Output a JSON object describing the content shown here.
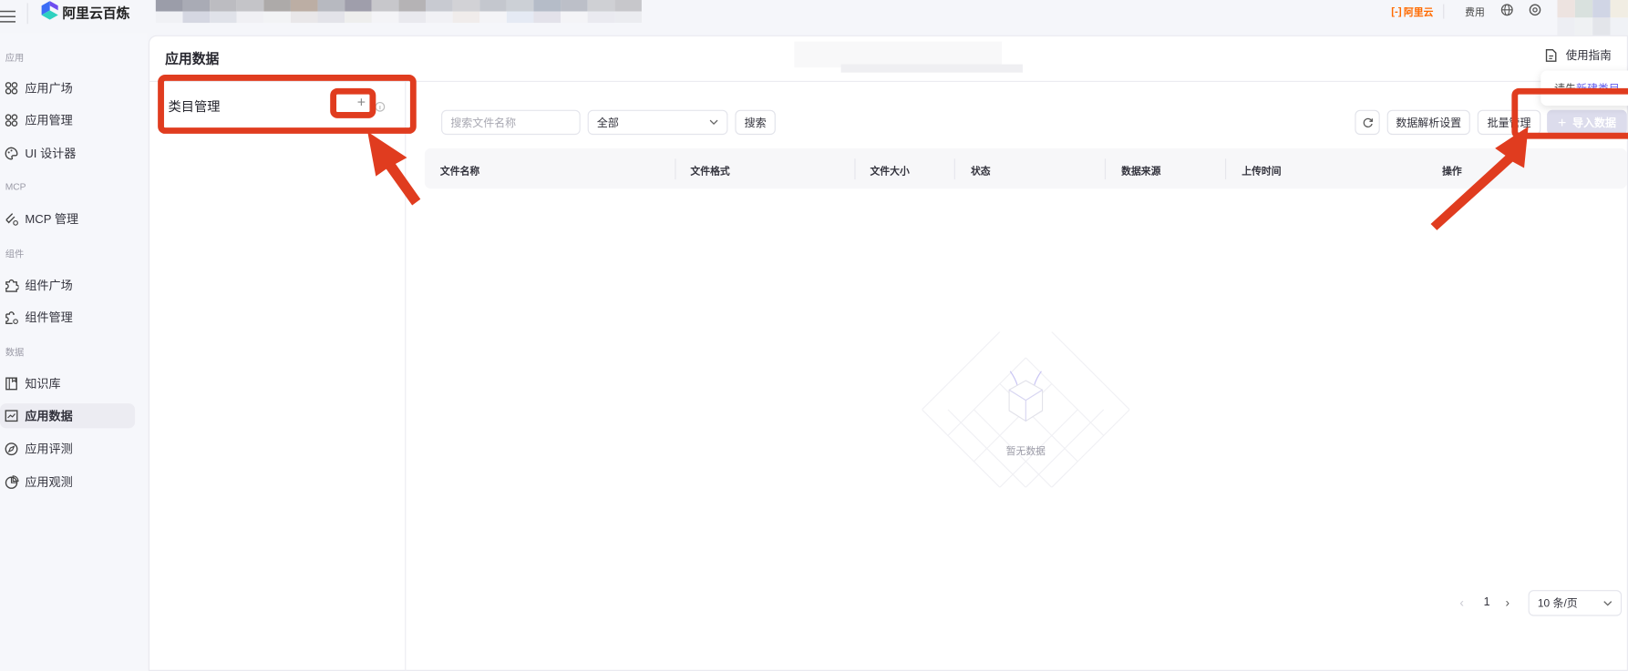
{
  "topbar": {
    "brand": "阿里云百炼",
    "aliyun_logo": "阿里云",
    "fees": "费用",
    "icons": [
      "menu-icon",
      "globe-icon",
      "gear-icon"
    ]
  },
  "sidebar": {
    "sections": [
      {
        "label": "应用",
        "items": [
          "应用广场",
          "应用管理",
          "UI 设计器"
        ]
      },
      {
        "label": "MCP",
        "items": [
          "MCP 管理"
        ]
      },
      {
        "label": "组件",
        "items": [
          "组件广场",
          "组件管理"
        ]
      },
      {
        "label": "数据",
        "items": [
          "知识库",
          "应用数据",
          "应用评测",
          "应用观测"
        ]
      }
    ],
    "active": "应用数据"
  },
  "page": {
    "title": "应用数据",
    "guide_link": "使用指南"
  },
  "category": {
    "title": "类目管理",
    "add": "+"
  },
  "tooltip": {
    "prefix": "请先",
    "link": "新建类目"
  },
  "toolbar": {
    "search_placeholder": "搜索文件名称",
    "filter_value": "全部",
    "search_button": "搜索",
    "parse_settings": "数据解析设置",
    "batch_manage": "批量管理",
    "import_data": "导入数据"
  },
  "table": {
    "columns": [
      "文件名称",
      "文件格式",
      "文件大小",
      "状态",
      "数据来源",
      "上传时间",
      "操作"
    ],
    "empty_text": "暂无数据"
  },
  "pagination": {
    "current_page": "1",
    "page_size": "10 条/页"
  },
  "colors": {
    "accent": "#615ced",
    "annotation": "#e03c1f",
    "brand_orange": "#ff6a00"
  }
}
